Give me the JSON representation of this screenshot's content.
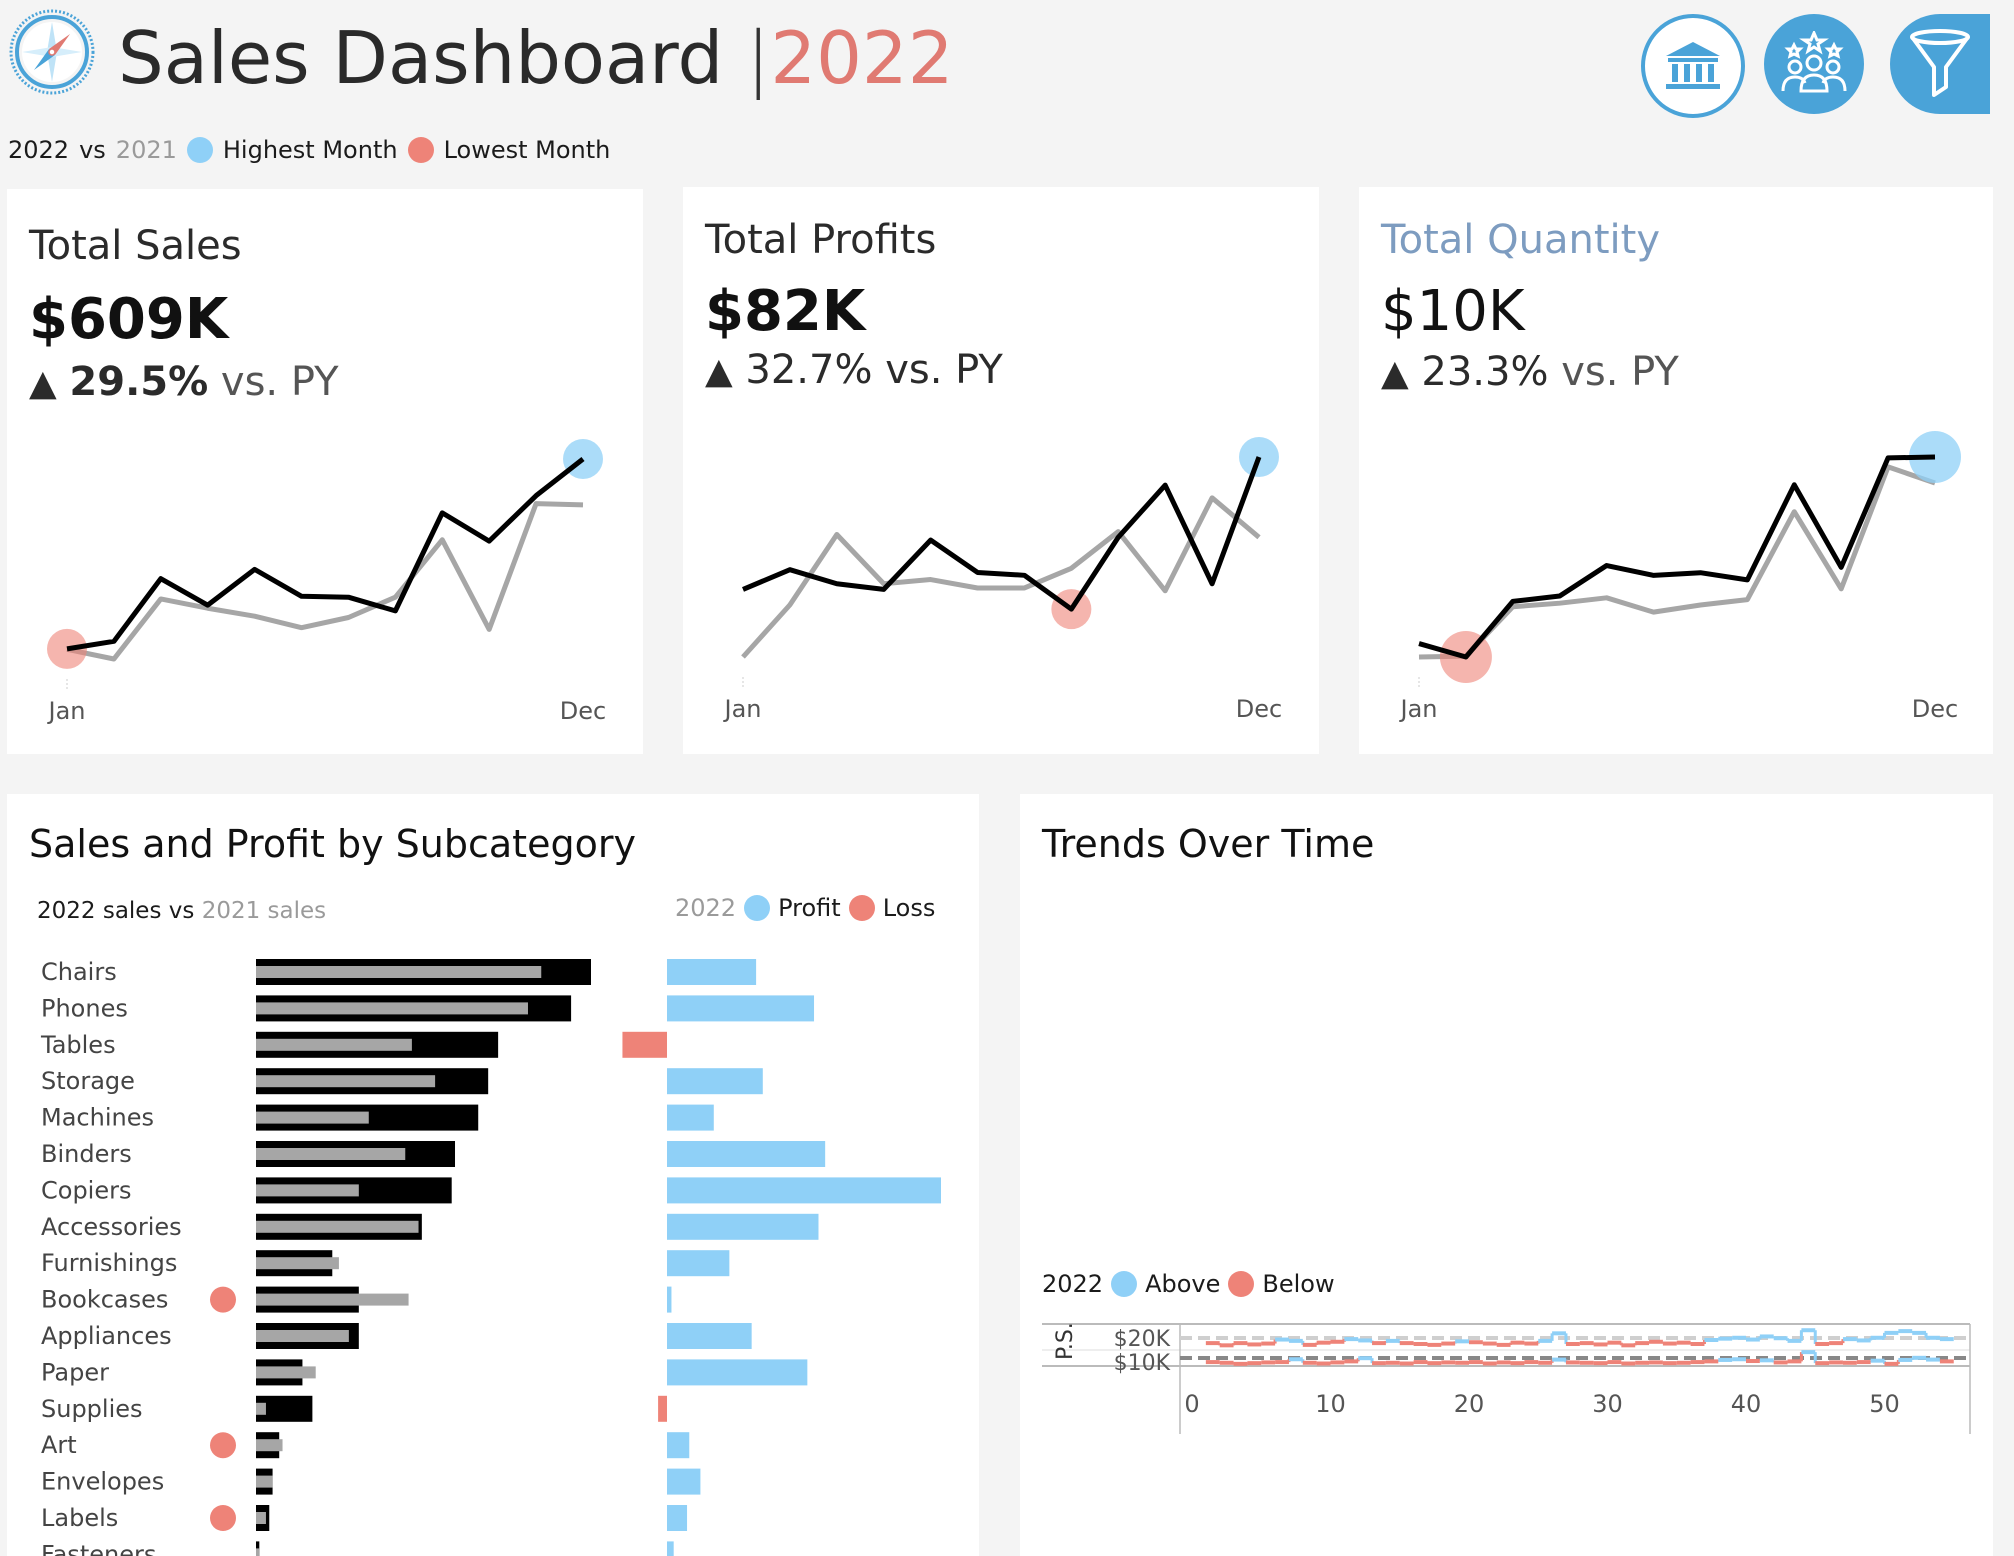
{
  "header": {
    "title": "Sales Dashboard",
    "separator": "|",
    "year": "2022"
  },
  "legend": {
    "current_year": "2022",
    "vs": "vs",
    "prior_year": "2021",
    "highest": "Highest Month",
    "lowest": "Lowest Month"
  },
  "colors": {
    "highlight_blue": "#8fd0f7",
    "highlight_red": "#ee8378",
    "accent_red": "#e07a72",
    "button_blue": "#4aa3d8",
    "current_line": "#000000",
    "prior_line": "#a6a6a6"
  },
  "icons": [
    "compass-logo-icon",
    "bank-icon",
    "people-icon",
    "filter-icon"
  ],
  "kpis": [
    {
      "label": "Total Sales",
      "value": "$609K",
      "arrow": "▲",
      "pct": "29.5%",
      "suffix": "vs. PY",
      "x_start": "Jan",
      "x_end": "Dec",
      "current": [
        13.9,
        15.6,
        29.8,
        23.8,
        31.9,
        25.8,
        25.6,
        22.5,
        44.7,
        38.3,
        48.6,
        56.9
      ],
      "prior": [
        13.8,
        11.6,
        25.2,
        23.1,
        21.3,
        18.7,
        21.0,
        25.6,
        38.6,
        18.3,
        46.8,
        46.5
      ],
      "max_month": 12,
      "min_month": 1,
      "ymax": 70
    },
    {
      "label": "Total Profits",
      "value": "$82K",
      "arrow": "▲",
      "pct": "32.7%",
      "suffix": "vs. PY",
      "x_start": "Jan",
      "x_end": "Dec",
      "current": [
        3.3,
        4.7,
        3.7,
        3.3,
        6.8,
        4.5,
        4.3,
        1.9,
        7.0,
        10.7,
        3.7,
        12.7
      ],
      "prior": [
        -1.5,
        2.2,
        7.2,
        3.7,
        4.0,
        3.4,
        3.4,
        4.8,
        7.4,
        3.2,
        9.8,
        7.0
      ],
      "max_month": 12,
      "min_month": 8,
      "ymax": 15,
      "ymin": -3
    },
    {
      "label": "Total Quantity",
      "value": "$10K",
      "arrow": "▲",
      "pct": "23.3%",
      "suffix": "vs. PY",
      "x_start": "Jan",
      "x_end": "Dec",
      "current": [
        585,
        510,
        820,
        850,
        1020,
        965,
        980,
        940,
        1470,
        1010,
        1620,
        1625
      ],
      "prior": [
        510,
        515,
        790,
        810,
        840,
        760,
        800,
        830,
        1320,
        890,
        1570,
        1480
      ],
      "max_month": 12,
      "min_month": 2,
      "ymax": 2000
    }
  ],
  "subcategory": {
    "title": "Sales and Profit by Subcategory",
    "legend_sales": {
      "cur": "2022 sales",
      "vs": "vs",
      "prior": "2021 sales"
    },
    "legend_profit": {
      "year": "2022",
      "profit": "Profit",
      "loss": "Loss"
    },
    "chart_data": {
      "type": "bar",
      "categories": [
        "Chairs",
        "Phones",
        "Tables",
        "Storage",
        "Machines",
        "Binders",
        "Copiers",
        "Accessories",
        "Furnishings",
        "Bookcases",
        "Appliances",
        "Paper",
        "Supplies",
        "Art",
        "Envelopes",
        "Labels",
        "Fasteners"
      ],
      "series": [
        {
          "name": "2022 sales",
          "values": [
            101,
            95,
            73,
            70,
            67,
            60,
            59,
            50,
            23,
            31,
            31,
            14,
            17,
            7,
            5,
            4,
            1
          ]
        },
        {
          "name": "2021 sales",
          "values": [
            86,
            82,
            47,
            54,
            34,
            45,
            31,
            49,
            25,
            46,
            28,
            18,
            3,
            8,
            5,
            3,
            1
          ]
        },
        {
          "name": "2022 profit",
          "values": [
            4.0,
            6.6,
            -2.0,
            4.3,
            2.1,
            7.1,
            12.3,
            6.8,
            2.8,
            0.2,
            3.8,
            6.3,
            -0.4,
            1.0,
            1.5,
            0.9,
            0.3
          ]
        }
      ],
      "low_flag_categories": [
        "Bookcases",
        "Art",
        "Labels"
      ]
    }
  },
  "trends": {
    "title": "Trends Over Time",
    "legend": {
      "year": "2022",
      "above": "Above",
      "below": "Below"
    },
    "chart_data": {
      "type": "line",
      "ylabel": "P.S.",
      "y_ticks": [
        "$20K",
        "$10K"
      ],
      "x_ticks": [
        0,
        10,
        20,
        30,
        40,
        50
      ],
      "xlim": [
        0,
        56
      ],
      "reference_lines": [
        19.0,
        10.0
      ],
      "series": [
        {
          "name": "Sales",
          "values": [
            18.6,
            18.1,
            18.6,
            18.3,
            18.5,
            19.4,
            19.1,
            18.2,
            18.7,
            18.9,
            19.5,
            19.2,
            18.6,
            19.1,
            18.6,
            18.4,
            18.2,
            18.5,
            19.0,
            18.8,
            18.5,
            18.2,
            18.7,
            18.5,
            19.1,
            20.8,
            18.4,
            18.6,
            18.3,
            18.7,
            18.1,
            18.6,
            18.9,
            18.5,
            18.7,
            18.4,
            19.3,
            19.6,
            19.8,
            19.4,
            20.1,
            19.7,
            19.1,
            21.5,
            18.4,
            18.6,
            19.5,
            19.2,
            19.8,
            20.9,
            21.3,
            20.9,
            19.8,
            19.5
          ]
        },
        {
          "name": "Profit",
          "values": [
            9.6,
            9.4,
            9.1,
            9.3,
            9.5,
            9.6,
            10.4,
            9.4,
            9.2,
            9.5,
            9.8,
            10.7,
            9.3,
            9.4,
            9.2,
            9.6,
            9.3,
            9.5,
            9.4,
            9.6,
            9.2,
            9.5,
            9.3,
            9.6,
            9.4,
            10.3,
            9.5,
            9.4,
            9.3,
            9.6,
            9.2,
            9.4,
            9.5,
            9.3,
            9.4,
            9.6,
            9.8,
            10.2,
            10.4,
            9.9,
            10.1,
            9.5,
            9.8,
            12.4,
            9.3,
            9.5,
            9.4,
            9.6,
            10.0,
            9.1,
            10.2,
            10.8,
            10.3,
            9.8
          ]
        }
      ]
    }
  }
}
